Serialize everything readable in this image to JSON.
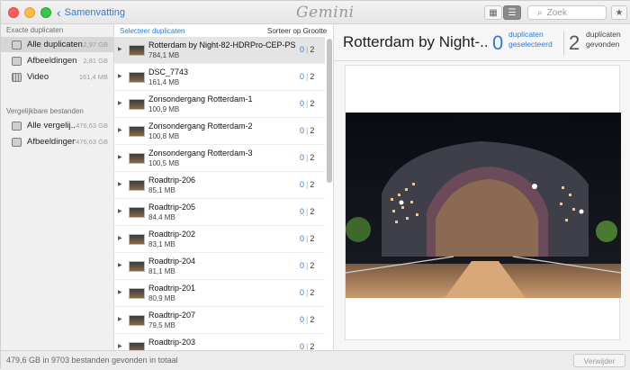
{
  "titlebar": {
    "back_label": "Samenvatting",
    "logo_text": "Gemini",
    "search_placeholder": "Zoek",
    "icons": [
      "grid-view-icon",
      "list-view-icon",
      "search-icon",
      "star-icon"
    ]
  },
  "sidebar": {
    "section_exact": "Exacte duplicaten",
    "exact_items": [
      {
        "label": "Alle duplicaten",
        "size": "2,97 GB",
        "icon": "duplicates-icon",
        "active": true
      },
      {
        "label": "Afbeeldingen",
        "size": "2,81 GB",
        "icon": "image-icon"
      },
      {
        "label": "Video",
        "size": "161,4 MB",
        "icon": "film-icon"
      }
    ],
    "section_similar": "Vergelijkbare bestanden",
    "similar_items": [
      {
        "label": "Alle vergelij...",
        "size": "476,63 GB",
        "icon": "duplicates-icon"
      },
      {
        "label": "Afbeeldingen",
        "size": "476,63 GB",
        "icon": "image-icon"
      }
    ]
  },
  "list": {
    "select_label": "Selecteer duplicaten",
    "sort_label": "Sorteer op Grootte",
    "rows": [
      {
        "name": "Rotterdam by Night-82-HDRPro-CEP-PS",
        "size": "784,1 MB",
        "selected": "0",
        "total": "2",
        "active": true
      },
      {
        "name": "DSC_7743",
        "size": "161,4 MB",
        "selected": "0",
        "total": "2"
      },
      {
        "name": "Zonsondergang Rotterdam-1",
        "size": "100,9 MB",
        "selected": "0",
        "total": "2"
      },
      {
        "name": "Zonsondergang Rotterdam-2",
        "size": "100,8 MB",
        "selected": "0",
        "total": "2"
      },
      {
        "name": "Zonsondergang Rotterdam-3",
        "size": "100,5 MB",
        "selected": "0",
        "total": "2"
      },
      {
        "name": "Roadtrip-206",
        "size": "85,1 MB",
        "selected": "0",
        "total": "2"
      },
      {
        "name": "Roadtrip-205",
        "size": "84,4 MB",
        "selected": "0",
        "total": "2"
      },
      {
        "name": "Roadtrip-202",
        "size": "83,1 MB",
        "selected": "0",
        "total": "2"
      },
      {
        "name": "Roadtrip-204",
        "size": "81,1 MB",
        "selected": "0",
        "total": "2"
      },
      {
        "name": "Roadtrip-201",
        "size": "80,9 MB",
        "selected": "0",
        "total": "2"
      },
      {
        "name": "Roadtrip-207",
        "size": "79,5 MB",
        "selected": "0",
        "total": "2"
      },
      {
        "name": "Roadtrip-203",
        "size": "",
        "selected": "0",
        "total": "2"
      }
    ]
  },
  "detail": {
    "title": "Rotterdam by Night-...",
    "selected_count": "0",
    "selected_label_1": "duplicaten",
    "selected_label_2": "geselecteerd",
    "found_count": "2",
    "found_label_1": "duplicaten",
    "found_label_2": "gevonden"
  },
  "status": {
    "text": "479,6 GB in 9703 bestanden gevonden in totaal",
    "delete_label": "Verwijder"
  }
}
